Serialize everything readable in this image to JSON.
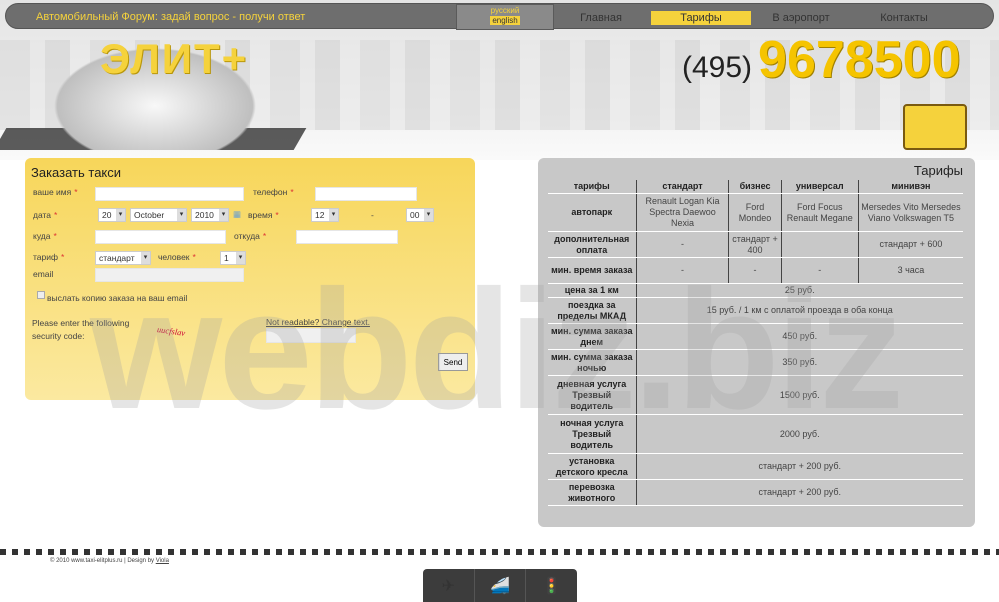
{
  "header": {
    "forum_link": "Автомобильный Форум: задай вопрос - получи ответ",
    "lang": [
      "русский",
      "english"
    ],
    "nav": [
      {
        "label": "Главная"
      },
      {
        "label": "Тарифы",
        "active": true
      },
      {
        "label": "В аэропорт"
      },
      {
        "label": "Контакты"
      }
    ],
    "logo": "ЭЛИТ+",
    "phone_code": "(495)",
    "phone_number": "9678500"
  },
  "form": {
    "title": "Заказать такси",
    "name_label": "ваше имя",
    "phone_label": "телефон",
    "date_label": "дата",
    "day": "20",
    "month": "October",
    "year": "2010",
    "time_label": "время",
    "hour": "12",
    "time_sep": "-",
    "minute": "00",
    "to_label": "куда",
    "from_label": "откуда",
    "tariff_label": "тариф",
    "tariff_value": "стандарт",
    "persons_label": "человек",
    "persons_value": "1",
    "email_label": "email",
    "copy_label": "выслать копию заказа на ваш email",
    "captcha_label": "Please enter the following security code:",
    "captcha_text": "uucfslav",
    "change_text": "Not readable? Change text.",
    "send": "Send",
    "required": "*"
  },
  "tariffs": {
    "title": "Тарифы",
    "header": [
      "тарифы",
      "стандарт",
      "бизнес",
      "универсал",
      "минивэн"
    ],
    "rows": [
      {
        "label": "автопарк",
        "cells": [
          "Renault Logan Kia Spectra Daewoo Nexia",
          "Ford Mondeo",
          "Ford Focus Renault Megane",
          "Mersedes Vito Mersedes Viano Volkswagen T5"
        ]
      },
      {
        "label": "дополнительная оплата",
        "cells": [
          "-",
          "стандарт + 400",
          "",
          "стандарт + 600"
        ]
      },
      {
        "label": "мин. время заказа",
        "cells": [
          "-",
          "-",
          "-",
          "3 часа"
        ]
      },
      {
        "label": "цена за 1 км",
        "value": "25 руб."
      },
      {
        "label": "поездка за пределы МКАД",
        "value": "15 руб. / 1 км с оплатой проезда в оба конца"
      },
      {
        "label": "мин. сумма заказа днем",
        "value": "450 руб."
      },
      {
        "label": "мин. сумма заказа ночью",
        "value": "350 руб."
      },
      {
        "label": "дневная услуга Трезвый водитель",
        "value": "1500 руб."
      },
      {
        "label": "ночная услуга Трезвый водитель",
        "value": "2000 руб."
      },
      {
        "label": "установка детского кресла",
        "value": "стандарт + 200 руб."
      },
      {
        "label": "перевозка животного",
        "value": "стандарт + 200 руб."
      }
    ]
  },
  "watermark": "webdiz.biz",
  "footer": {
    "copyright": "© 2010 www.taxi-elitplus.ru | Design by ",
    "designer": "Viola",
    "dock": [
      "airport-icon",
      "train-icon",
      "traffic-light-icon"
    ]
  }
}
